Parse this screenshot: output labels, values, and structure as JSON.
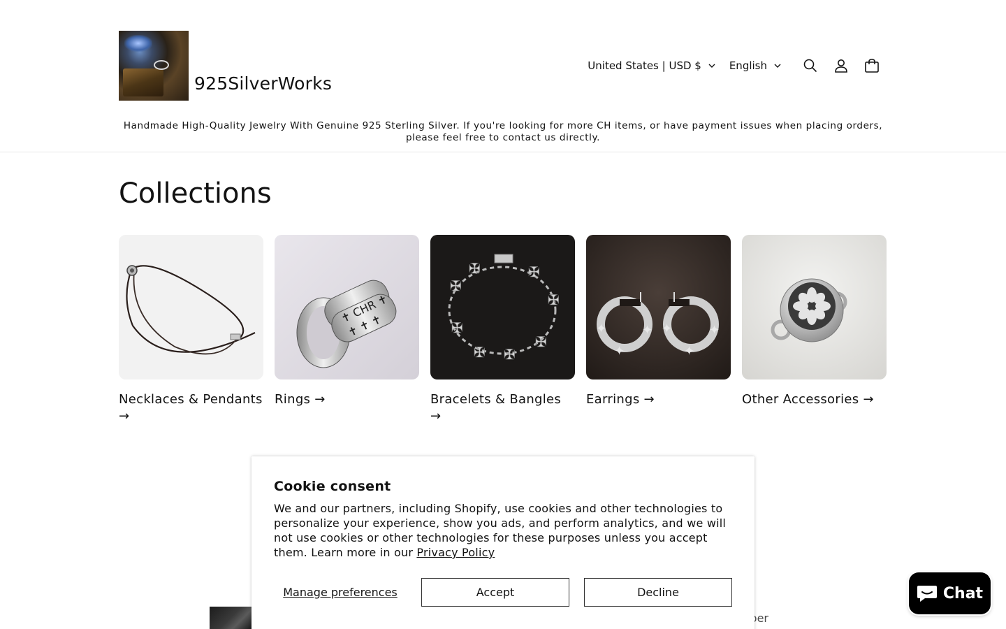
{
  "header": {
    "brand_name": "925SilverWorks",
    "country_selector": "United States | USD $",
    "language_selector": "English",
    "icons": [
      "search-icon",
      "account-icon",
      "cart-icon"
    ],
    "announcement": "Handmade High-Quality Jewelry With Genuine 925 Sterling Silver. If you're looking for more CH items, or have payment issues when placing orders, please feel free to contact us directly."
  },
  "main": {
    "title": "Collections",
    "collections": [
      {
        "label": "Necklaces & Pendants →"
      },
      {
        "label": "Rings →"
      },
      {
        "label": "Bracelets & Bangles →"
      },
      {
        "label": "Earrings →"
      },
      {
        "label": "Other Accessories →"
      }
    ],
    "partial_text": "s per"
  },
  "cookie": {
    "title": "Cookie consent",
    "body": "We and our partners, including Shopify, use cookies and other technologies to personalize your experience, show you ads, and perform analytics, and we will not use cookies or other technologies for these purposes unless you accept them. Learn more in our ",
    "privacy_link": "Privacy Policy",
    "manage_label": "Manage preferences",
    "accept_label": "Accept",
    "decline_label": "Decline"
  },
  "chat": {
    "label": "Chat"
  },
  "colors": {
    "text": "#121212",
    "chat_bg": "#000000",
    "divider": "#e6e6e6"
  }
}
